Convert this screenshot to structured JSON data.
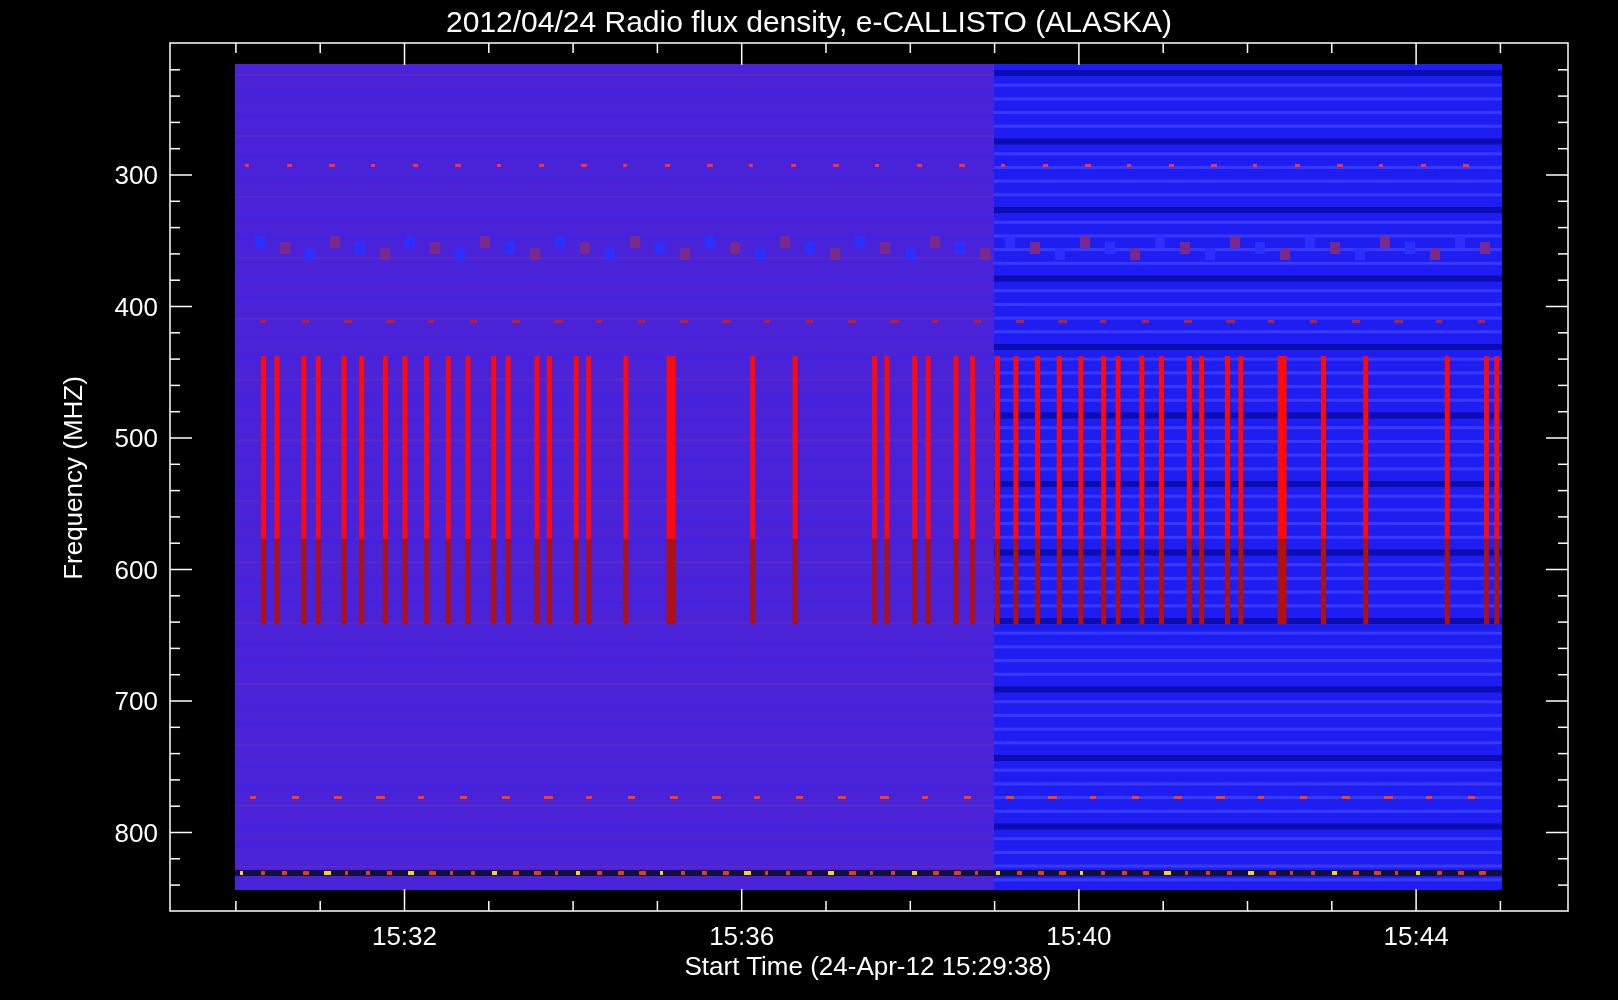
{
  "plot": {
    "title": "2012/04/24  Radio flux density, e-CALLISTO (ALASKA)",
    "ylabel": "Frequency (MHZ)",
    "xlabel": "Start Time (24-Apr-12 15:29:38)",
    "y_tick_labels": [
      "300",
      "400",
      "500",
      "600",
      "700",
      "800"
    ],
    "x_tick_labels": [
      "15:32",
      "15:36",
      "15:40",
      "15:44"
    ]
  }
}
